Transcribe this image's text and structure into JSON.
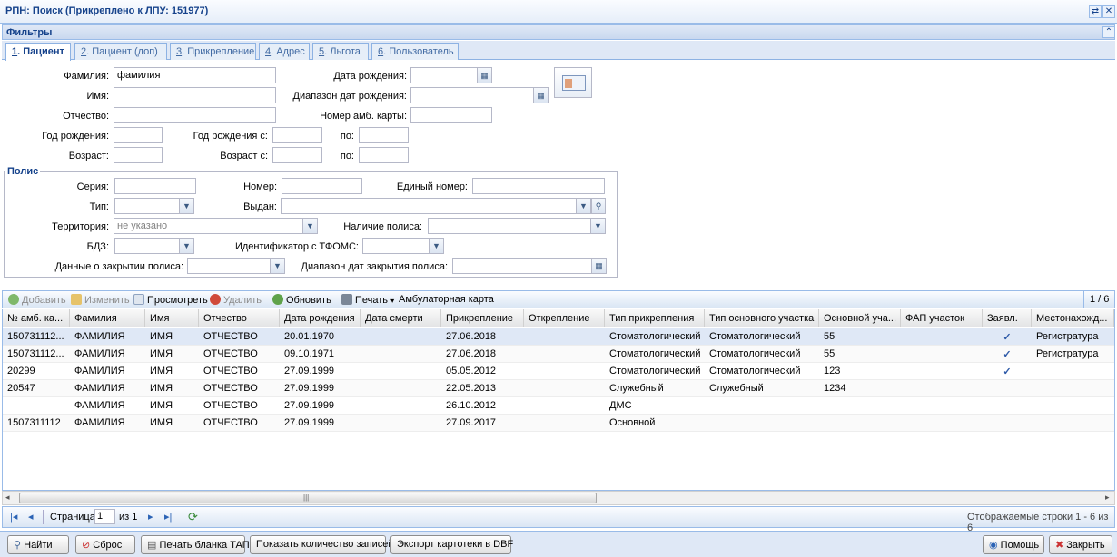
{
  "window": {
    "title": "РПН: Поиск (Прикреплено к ЛПУ: 151977)"
  },
  "filters": {
    "title": "Фильтры"
  },
  "tabs": [
    {
      "key": "1",
      "label": ". Пациент"
    },
    {
      "key": "2",
      "label": ". Пациент (доп)"
    },
    {
      "key": "3",
      "label": ". Прикрепление"
    },
    {
      "key": "4",
      "label": ". Адрес"
    },
    {
      "key": "5",
      "label": ". Льгота"
    },
    {
      "key": "6",
      "label": ". Пользователь"
    }
  ],
  "form": {
    "surname_label": "Фамилия:",
    "surname_value": "фамилия",
    "name_label": "Имя:",
    "patronymic_label": "Отчество:",
    "birthdate_label": "Дата рождения:",
    "birthdate_range_label": "Диапазон дат рождения:",
    "amb_card_label": "Номер амб. карты:",
    "birth_year_label": "Год рождения:",
    "birth_year_from_label": "Год рождения с:",
    "to_label": "по:",
    "age_label": "Возраст:",
    "age_from_label": "Возраст с:",
    "policy_legend": "Полис",
    "series_label": "Серия:",
    "number_label": "Номер:",
    "unified_number_label": "Единый номер:",
    "type_label": "Тип:",
    "issued_label": "Выдан:",
    "territory_label": "Территория:",
    "territory_value": "не указано",
    "policy_presence_label": "Наличие полиса:",
    "bdz_label": "БДЗ:",
    "tfoms_label": "Идентификатор с ТФОМС:",
    "closing_data_label": "Данные о закрытии полиса:",
    "closing_range_label": "Диапазон дат закрытия полиса:"
  },
  "grid_toolbar": {
    "add": "Добавить",
    "edit": "Изменить",
    "view": "Просмотреть",
    "delete": "Удалить",
    "refresh": "Обновить",
    "print": "Печать",
    "amb_card": "Амбулаторная карта",
    "counter": "1 / 6"
  },
  "grid": {
    "columns": [
      "№ амб. ка...",
      "Фамилия",
      "Имя",
      "Отчество",
      "Дата рождения",
      "Дата смерти",
      "Прикрепление",
      "Открепление",
      "Тип прикрепления",
      "Тип основного участка",
      "Основной уча...",
      "ФАП участок",
      "Заявл.",
      "Местонахожд..."
    ],
    "rows": [
      [
        "150731112...",
        "ФАМИЛИЯ",
        "ИМЯ",
        "ОТЧЕСТВО",
        "20.01.1970",
        "",
        "27.06.2018",
        "",
        "Стоматологический",
        "Стоматологический",
        "55",
        "",
        "✓",
        "Регистратура"
      ],
      [
        "150731112...",
        "ФАМИЛИЯ",
        "ИМЯ",
        "ОТЧЕСТВО",
        "09.10.1971",
        "",
        "27.06.2018",
        "",
        "Стоматологический",
        "Стоматологический",
        "55",
        "",
        "✓",
        "Регистратура"
      ],
      [
        "20299",
        "ФАМИЛИЯ",
        "ИМЯ",
        "ОТЧЕСТВО",
        "27.09.1999",
        "",
        "05.05.2012",
        "",
        "Стоматологический",
        "Стоматологический",
        "123",
        "",
        "✓",
        ""
      ],
      [
        "20547",
        "ФАМИЛИЯ",
        "ИМЯ",
        "ОТЧЕСТВО",
        "27.09.1999",
        "",
        "22.05.2013",
        "",
        "Служебный",
        "Служебный",
        "1234",
        "",
        "",
        ""
      ],
      [
        "",
        "ФАМИЛИЯ",
        "ИМЯ",
        "ОТЧЕСТВО",
        "27.09.1999",
        "",
        "26.10.2012",
        "",
        "ДМС",
        "",
        "",
        "",
        "",
        ""
      ],
      [
        "1507311112",
        "ФАМИЛИЯ",
        "ИМЯ",
        "ОТЧЕСТВО",
        "27.09.1999",
        "",
        "27.09.2017",
        "",
        "Основной",
        "",
        "",
        "",
        "",
        ""
      ]
    ]
  },
  "pager": {
    "page_label": "Страница",
    "page_value": "1",
    "of_label": "из 1",
    "display_info": "Отображаемые строки 1 - 6 из 6"
  },
  "bottom": {
    "find": "Найти",
    "reset": "Сброс",
    "print_tap": "Печать бланка ТАП",
    "show_count": "Показать количество записей",
    "export": "Экспорт картотеки в DBF",
    "help": "Помощь",
    "close": "Закрыть"
  }
}
